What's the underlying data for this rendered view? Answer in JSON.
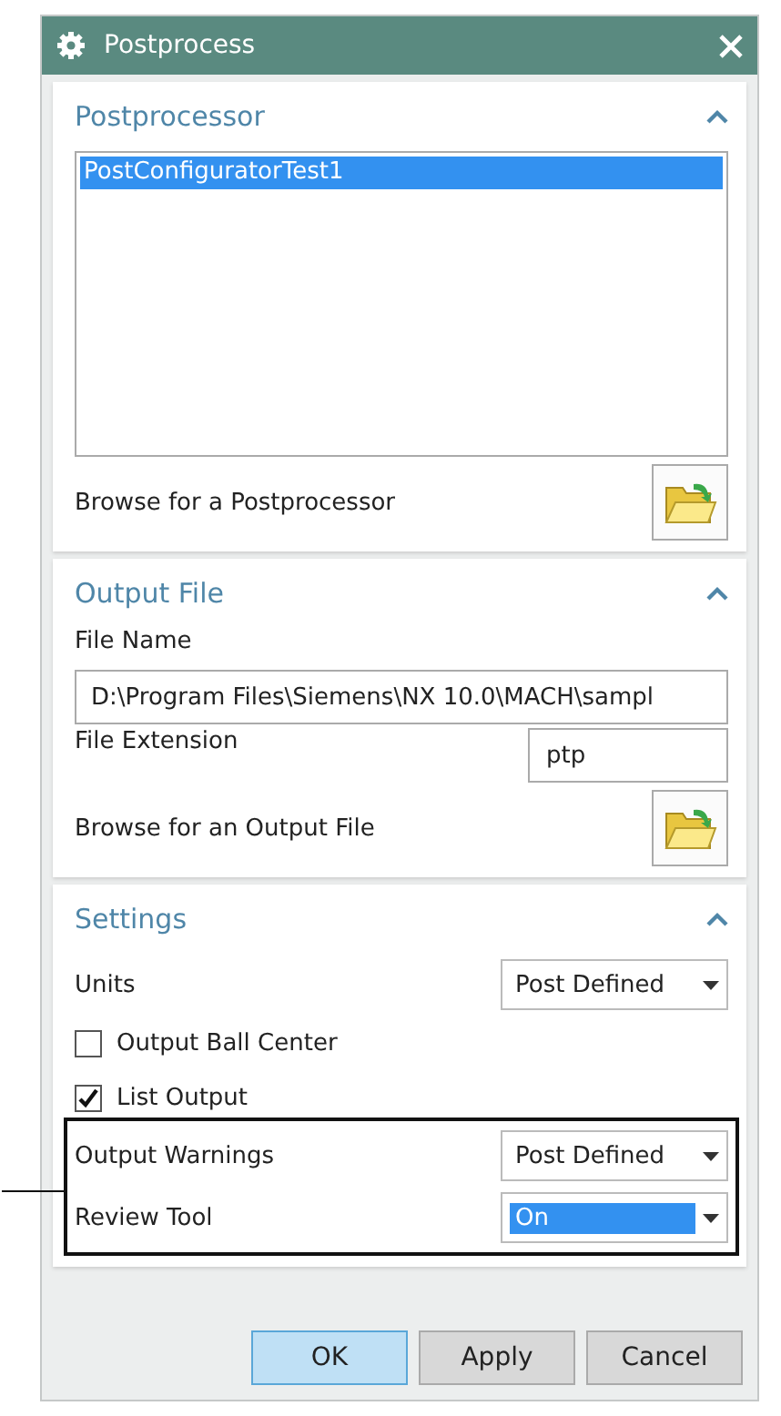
{
  "window": {
    "title": "Postprocess"
  },
  "postprocessor": {
    "title": "Postprocessor",
    "expanded": true,
    "list": [
      {
        "label": "PostConfiguratorTest1",
        "selected": true
      }
    ],
    "browse_label": "Browse for a Postprocessor"
  },
  "output_file": {
    "title": "Output File",
    "expanded": true,
    "file_name_label": "File Name",
    "file_name_value": "D:\\Program Files\\Siemens\\NX 10.0\\MACH\\sampl",
    "extension_label": "File Extension",
    "extension_value": "ptp",
    "browse_label": "Browse for an Output File"
  },
  "settings": {
    "title": "Settings",
    "expanded": true,
    "rows": [
      {
        "kind": "dropdown",
        "label": "Units",
        "value": "Post Defined",
        "highlighted": false
      },
      {
        "kind": "checkbox",
        "label": "Output Ball Center",
        "checked": false
      },
      {
        "kind": "checkbox",
        "label": "List Output",
        "checked": true
      }
    ],
    "callout_rows": [
      {
        "kind": "dropdown",
        "label": "Output Warnings",
        "value": "Post Defined",
        "highlighted": false
      },
      {
        "kind": "dropdown",
        "label": "Review Tool",
        "value": "On",
        "highlighted": true
      }
    ]
  },
  "buttons": [
    {
      "label": "OK",
      "default": true
    },
    {
      "label": "Apply",
      "default": false
    },
    {
      "label": "Cancel",
      "default": false
    }
  ]
}
